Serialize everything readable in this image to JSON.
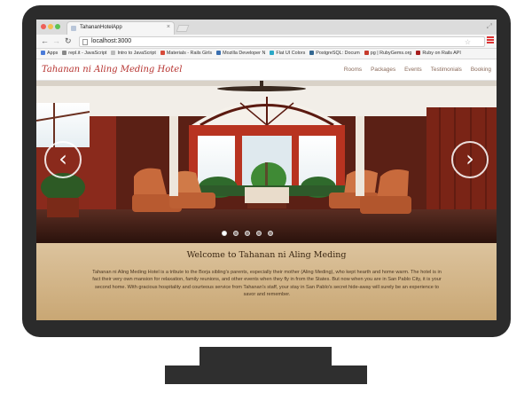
{
  "browser": {
    "tab_title": "TahananHotelApp",
    "url": "localhost:3000",
    "bookmarks": [
      {
        "label": "Apps",
        "color": "#4a7bd8"
      },
      {
        "label": "repl.it - JavaScript",
        "color": "#888888"
      },
      {
        "label": "Intro to JavaScript",
        "color": "#bbbbbb"
      },
      {
        "label": "Materials - Rails Girls",
        "color": "#d64b3a"
      },
      {
        "label": "Mozilla Developer N",
        "color": "#3a6fb0"
      },
      {
        "label": "Flat UI Colors",
        "color": "#2aa8c7"
      },
      {
        "label": "PostgreSQL: Docum",
        "color": "#336791"
      },
      {
        "label": "pg | RubyGems.org",
        "color": "#c63a2b"
      },
      {
        "label": "Ruby on Rails API",
        "color": "#a61d1d"
      }
    ]
  },
  "site": {
    "brand": "Tahanan ni Aling Meding Hotel",
    "nav": [
      "Rooms",
      "Packages",
      "Events",
      "Testimonials",
      "Booking"
    ],
    "carousel": {
      "slides": 5,
      "active": 0
    },
    "welcome_title": "Welcome to Tahanan ni Aling Meding",
    "welcome_text": "Tahanan ni Aling Meding Hotel is a tribute to the Borja sibling's parents, especially their mother (Aling Meding), who kept hearth and home warm. The hotel is in fact their very own mansion for relaxation, family reunions, and other events when they fly in from the States. But now when you are in San Pablo City, it is your second home. With gracious hospitality and courteous service from Tahanan's staff, your stay in San Pablo's secret hide-away will surely be an experience to savor and remember."
  }
}
